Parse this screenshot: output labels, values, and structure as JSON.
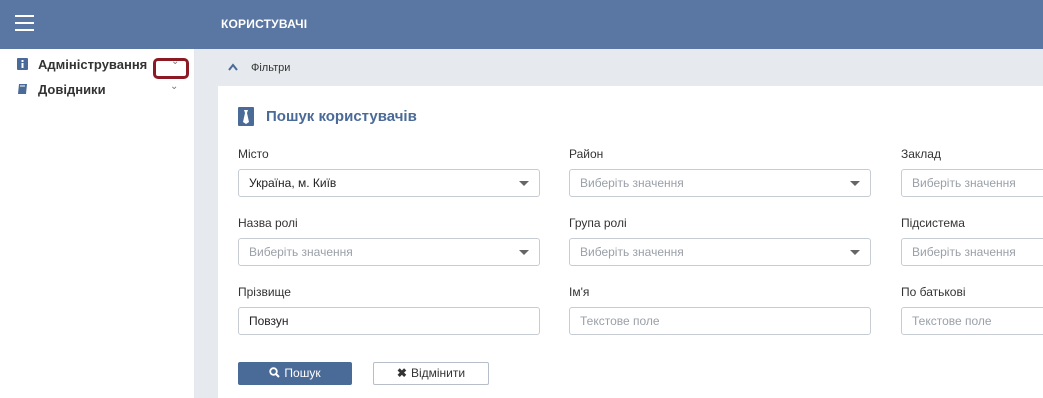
{
  "header": {
    "title": "КОРИСТУВАЧІ",
    "menu_icon": "hamburger-icon"
  },
  "sidebar": {
    "items": [
      {
        "label": "Адміністрування",
        "icon": "badge-icon",
        "chevron": "chevron-down-icon"
      },
      {
        "label": "Довідники",
        "icon": "book-icon",
        "chevron": "chevron-down-icon"
      }
    ]
  },
  "filters": {
    "toggle_label": "Фільтри",
    "icon": "chevron-up-icon"
  },
  "panel": {
    "title": "Пошук користувачів",
    "icon": "tie-icon",
    "fields": [
      {
        "label": "Місто",
        "value": "Україна, м. Київ",
        "placeholder": "",
        "type": "select"
      },
      {
        "label": "Район",
        "value": "",
        "placeholder": "Виберіть значення",
        "type": "select"
      },
      {
        "label": "Заклад",
        "value": "",
        "placeholder": "Виберіть значення",
        "type": "select"
      },
      {
        "label": "Назва ролі",
        "value": "",
        "placeholder": "Виберіть значення",
        "type": "select"
      },
      {
        "label": "Група ролі",
        "value": "",
        "placeholder": "Виберіть значення",
        "type": "select"
      },
      {
        "label": "Підсистема",
        "value": "",
        "placeholder": "Виберіть значення",
        "type": "select"
      },
      {
        "label": "Прізвище",
        "value": "Повзун",
        "placeholder": "",
        "type": "text"
      },
      {
        "label": "Ім'я",
        "value": "",
        "placeholder": "Текстове поле",
        "type": "text"
      },
      {
        "label": "По батькові",
        "value": "",
        "placeholder": "Текстове поле",
        "type": "text"
      }
    ],
    "search_button": "Пошук",
    "cancel_button": "Відмінити"
  },
  "colors": {
    "header_bg": "#5a76a3",
    "accent": "#4a6a97",
    "highlight": "#8b1a24",
    "main_bg": "#e6e9ee"
  }
}
